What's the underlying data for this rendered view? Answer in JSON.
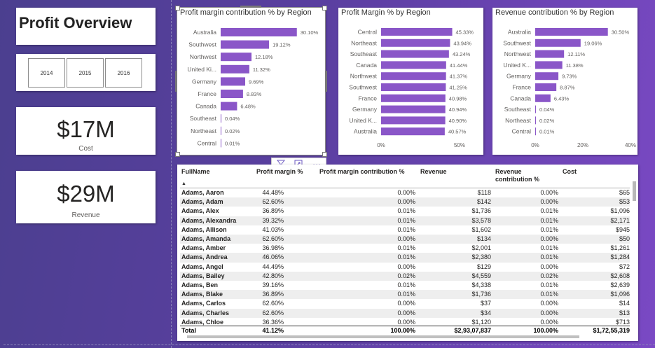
{
  "title": "Profit Overview",
  "years": [
    "2014",
    "2015",
    "2016"
  ],
  "kpis": {
    "cost": {
      "value": "$17M",
      "label": "Cost"
    },
    "revenue": {
      "value": "$29M",
      "label": "Revenue"
    }
  },
  "colors": {
    "bar": "#8a56c8",
    "label": "#605e5c"
  },
  "visual_icons": [
    "filter-icon",
    "focus-mode-icon",
    "more-options-icon"
  ],
  "chart_data": [
    {
      "type": "bar",
      "title": "Profit margin contribution % by Region",
      "categories": [
        "Australia",
        "Southwest",
        "Northwest",
        "United Ki...",
        "Germany",
        "France",
        "Canada",
        "Southeast",
        "Northeast",
        "Central"
      ],
      "values": [
        30.1,
        19.12,
        12.18,
        11.32,
        9.69,
        8.83,
        6.48,
        0.04,
        0.02,
        0.01
      ],
      "data_labels": [
        "30.10%",
        "19.12%",
        "12.18%",
        "11.32%",
        "9.69%",
        "8.83%",
        "6.48%",
        "0.04%",
        "0.02%",
        "0.01%"
      ],
      "xlim": [
        0,
        31
      ],
      "ticks": []
    },
    {
      "type": "bar",
      "title": "Profit Margin % by Region",
      "categories": [
        "Central",
        "Northeast",
        "Southeast",
        "Canada",
        "Northwest",
        "Southwest",
        "France",
        "Germany",
        "United K...",
        "Australia"
      ],
      "values": [
        45.33,
        43.94,
        43.24,
        41.44,
        41.37,
        41.25,
        40.98,
        40.94,
        40.9,
        40.57
      ],
      "data_labels": [
        "45.33%",
        "43.94%",
        "43.24%",
        "41.44%",
        "41.37%",
        "41.25%",
        "40.98%",
        "40.94%",
        "40.90%",
        "40.57%"
      ],
      "xlim": [
        0,
        50
      ],
      "ticks": [
        {
          "value": 0,
          "label": "0%"
        },
        {
          "value": 50,
          "label": "50%"
        }
      ]
    },
    {
      "type": "bar",
      "title": "Revenue contribution % by Region",
      "categories": [
        "Australia",
        "Southwest",
        "Northwest",
        "United K...",
        "Germany",
        "France",
        "Canada",
        "Southeast",
        "Northeast",
        "Central"
      ],
      "values": [
        30.5,
        19.06,
        12.11,
        11.38,
        9.73,
        8.87,
        6.43,
        0.04,
        0.02,
        0.01
      ],
      "data_labels": [
        "30.50%",
        "19.06%",
        "12.11%",
        "11.38%",
        "9.73%",
        "8.87%",
        "6.43%",
        "0.04%",
        "0.02%",
        "0.01%"
      ],
      "xlim": [
        0,
        40
      ],
      "ticks": [
        {
          "value": 0,
          "label": "0%"
        },
        {
          "value": 20,
          "label": "20%"
        },
        {
          "value": 40,
          "label": "40%"
        }
      ]
    }
  ],
  "table": {
    "columns": [
      "FullName",
      "Profit margin %",
      "Profit margin contribution %",
      "Revenue",
      "Revenue contribution %",
      "Cost"
    ],
    "sort_indicator": "▲",
    "rows": [
      [
        "Adams, Aaron",
        "44.48%",
        "0.00%",
        "$118",
        "0.00%",
        "$65"
      ],
      [
        "Adams, Adam",
        "62.60%",
        "0.00%",
        "$142",
        "0.00%",
        "$53"
      ],
      [
        "Adams, Alex",
        "36.89%",
        "0.01%",
        "$1,736",
        "0.01%",
        "$1,096"
      ],
      [
        "Adams, Alexandra",
        "39.32%",
        "0.01%",
        "$3,578",
        "0.01%",
        "$2,171"
      ],
      [
        "Adams, Allison",
        "41.03%",
        "0.01%",
        "$1,602",
        "0.01%",
        "$945"
      ],
      [
        "Adams, Amanda",
        "62.60%",
        "0.00%",
        "$134",
        "0.00%",
        "$50"
      ],
      [
        "Adams, Amber",
        "36.98%",
        "0.01%",
        "$2,001",
        "0.01%",
        "$1,261"
      ],
      [
        "Adams, Andrea",
        "46.06%",
        "0.01%",
        "$2,380",
        "0.01%",
        "$1,284"
      ],
      [
        "Adams, Angel",
        "44.49%",
        "0.00%",
        "$129",
        "0.00%",
        "$72"
      ],
      [
        "Adams, Bailey",
        "42.80%",
        "0.02%",
        "$4,559",
        "0.02%",
        "$2,608"
      ],
      [
        "Adams, Ben",
        "39.16%",
        "0.01%",
        "$4,338",
        "0.01%",
        "$2,639"
      ],
      [
        "Adams, Blake",
        "36.89%",
        "0.01%",
        "$1,736",
        "0.01%",
        "$1,096"
      ],
      [
        "Adams, Carlos",
        "62.60%",
        "0.00%",
        "$37",
        "0.00%",
        "$14"
      ],
      [
        "Adams, Charles",
        "62.60%",
        "0.00%",
        "$34",
        "0.00%",
        "$13"
      ],
      [
        "Adams, Chloe",
        "36.36%",
        "0.00%",
        "$1,120",
        "0.00%",
        "$713"
      ]
    ],
    "total": [
      "Total",
      "41.12%",
      "100.00%",
      "$2,93,07,837",
      "100.00%",
      "$1,72,55,319"
    ]
  }
}
